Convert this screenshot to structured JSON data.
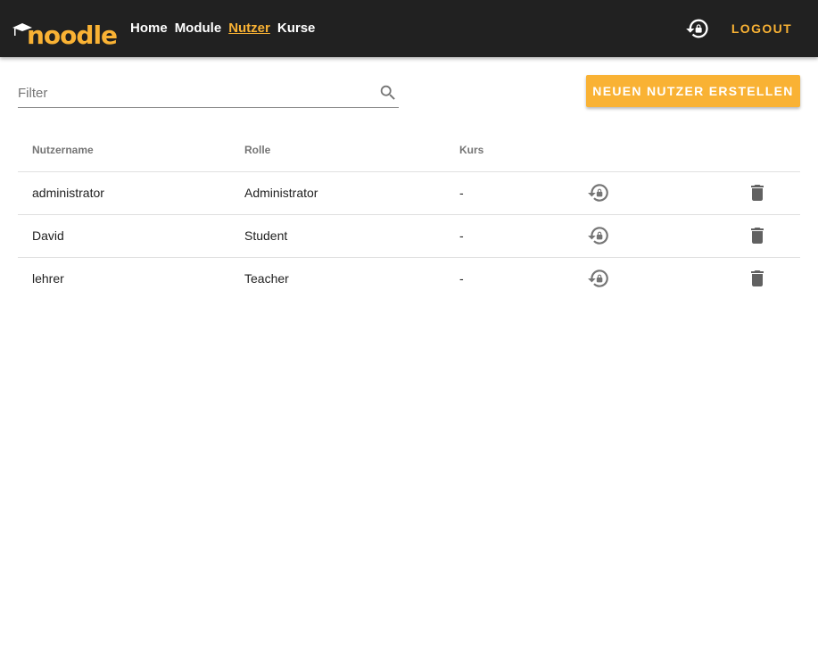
{
  "header": {
    "logo_text": "noodle",
    "nav": [
      {
        "label": "Home",
        "active": false
      },
      {
        "label": "Module",
        "active": false
      },
      {
        "label": "Nutzer",
        "active": true
      },
      {
        "label": "Kurse",
        "active": false
      }
    ],
    "logout_label": "LOGOUT",
    "reset_icon": "lock-reset-icon"
  },
  "toolbar": {
    "filter_placeholder": "Filter",
    "filter_value": "",
    "search_icon": "search-icon",
    "create_label": "NEUEN NUTZER ERSTELLEN"
  },
  "table": {
    "headers": [
      "Nutzername",
      "Rolle",
      "Kurs"
    ],
    "rows": [
      {
        "username": "administrator",
        "role": "Administrator",
        "course": "-"
      },
      {
        "username": "David",
        "role": "Student",
        "course": "-"
      },
      {
        "username": "lehrer",
        "role": "Teacher",
        "course": "-"
      }
    ],
    "row_icons": [
      "lock-reset-icon",
      "delete-icon"
    ]
  },
  "colors": {
    "accent": "#f9b234",
    "topbar": "#212121",
    "icon_gray": "#757575",
    "delete_icon": "#616161"
  }
}
